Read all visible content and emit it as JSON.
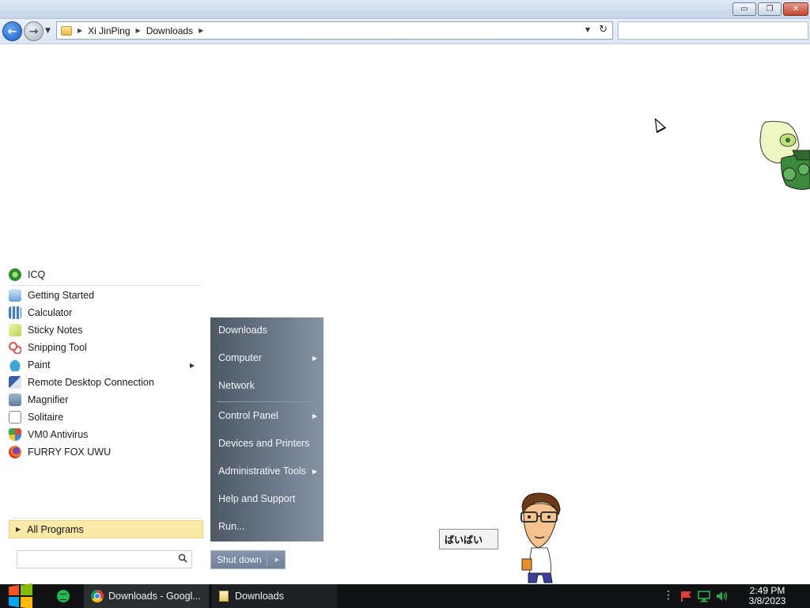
{
  "explorer": {
    "window_buttons": {
      "minimize": "▭",
      "maximize": "❐",
      "close": "✕"
    },
    "nav": {
      "back_glyph": "←",
      "forward_glyph": "→",
      "recent_glyph": "▼"
    },
    "breadcrumb": [
      "Xi JinPing",
      "Downloads"
    ],
    "crumb_arrow": "▶",
    "address_dropdown_glyph": "▼",
    "refresh_glyph": "↻",
    "search_placeholder": ""
  },
  "start_menu": {
    "pinned": [
      {
        "label": "ICQ",
        "icon": "icq-icon",
        "color": "#2e8b2e"
      }
    ],
    "programs": [
      {
        "label": "Getting Started",
        "icon": "getting-started-icon",
        "color": "#6aa3d8"
      },
      {
        "label": "Calculator",
        "icon": "calculator-icon",
        "color": "#4a7fbf"
      },
      {
        "label": "Sticky Notes",
        "icon": "sticky-notes-icon",
        "color": "#d7e86a"
      },
      {
        "label": "Snipping Tool",
        "icon": "snipping-tool-icon",
        "color": "#d94a4a"
      },
      {
        "label": "Paint",
        "icon": "paint-icon",
        "color": "#3ea7d8",
        "has_submenu": true
      },
      {
        "label": "Remote Desktop Connection",
        "icon": "remote-desktop-icon",
        "color": "#3a5fa8"
      },
      {
        "label": "Magnifier",
        "icon": "magnifier-icon",
        "color": "#5f7fa0"
      },
      {
        "label": "Solitaire",
        "icon": "solitaire-icon",
        "color": "#7a8a99"
      },
      {
        "label": "VM0 Antivirus",
        "icon": "shield-icon",
        "color": "#c9a02a"
      },
      {
        "label": "FURRY FOX UWU",
        "icon": "firefox-icon",
        "color": "#e2661f"
      }
    ],
    "submenu_arrow": "▶",
    "all_programs_label": "All Programs",
    "all_programs_arrow": "▶",
    "search_placeholder": "",
    "right_items": [
      {
        "label": "Downloads",
        "has_submenu": false
      },
      {
        "label": "Computer",
        "has_submenu": true
      },
      {
        "label": "Network",
        "has_submenu": false
      },
      {
        "label": "Control Panel",
        "has_submenu": true
      },
      {
        "label": "Devices and Printers",
        "has_submenu": false
      },
      {
        "label": "Administrative Tools",
        "has_submenu": true
      },
      {
        "label": "Help and Support",
        "has_submenu": false
      },
      {
        "label": "Run...",
        "has_submenu": false
      }
    ],
    "shutdown_label": "Shut down",
    "shutdown_arrow": "▶"
  },
  "byebye_text": "ばいばい",
  "taskbar": {
    "tasks": [
      {
        "label": "Downloads - Googl...",
        "icon": "chrome-icon"
      },
      {
        "label": "Downloads",
        "icon": "folder-icon"
      }
    ],
    "tray_more_glyph": "⋮",
    "clock_time": "2:49 PM",
    "clock_date": "3/8/2023"
  },
  "colors": {
    "start_right_pane": "#5f6b7b",
    "all_programs_highlight": "#fbe9a8",
    "taskbar": "#101214"
  }
}
